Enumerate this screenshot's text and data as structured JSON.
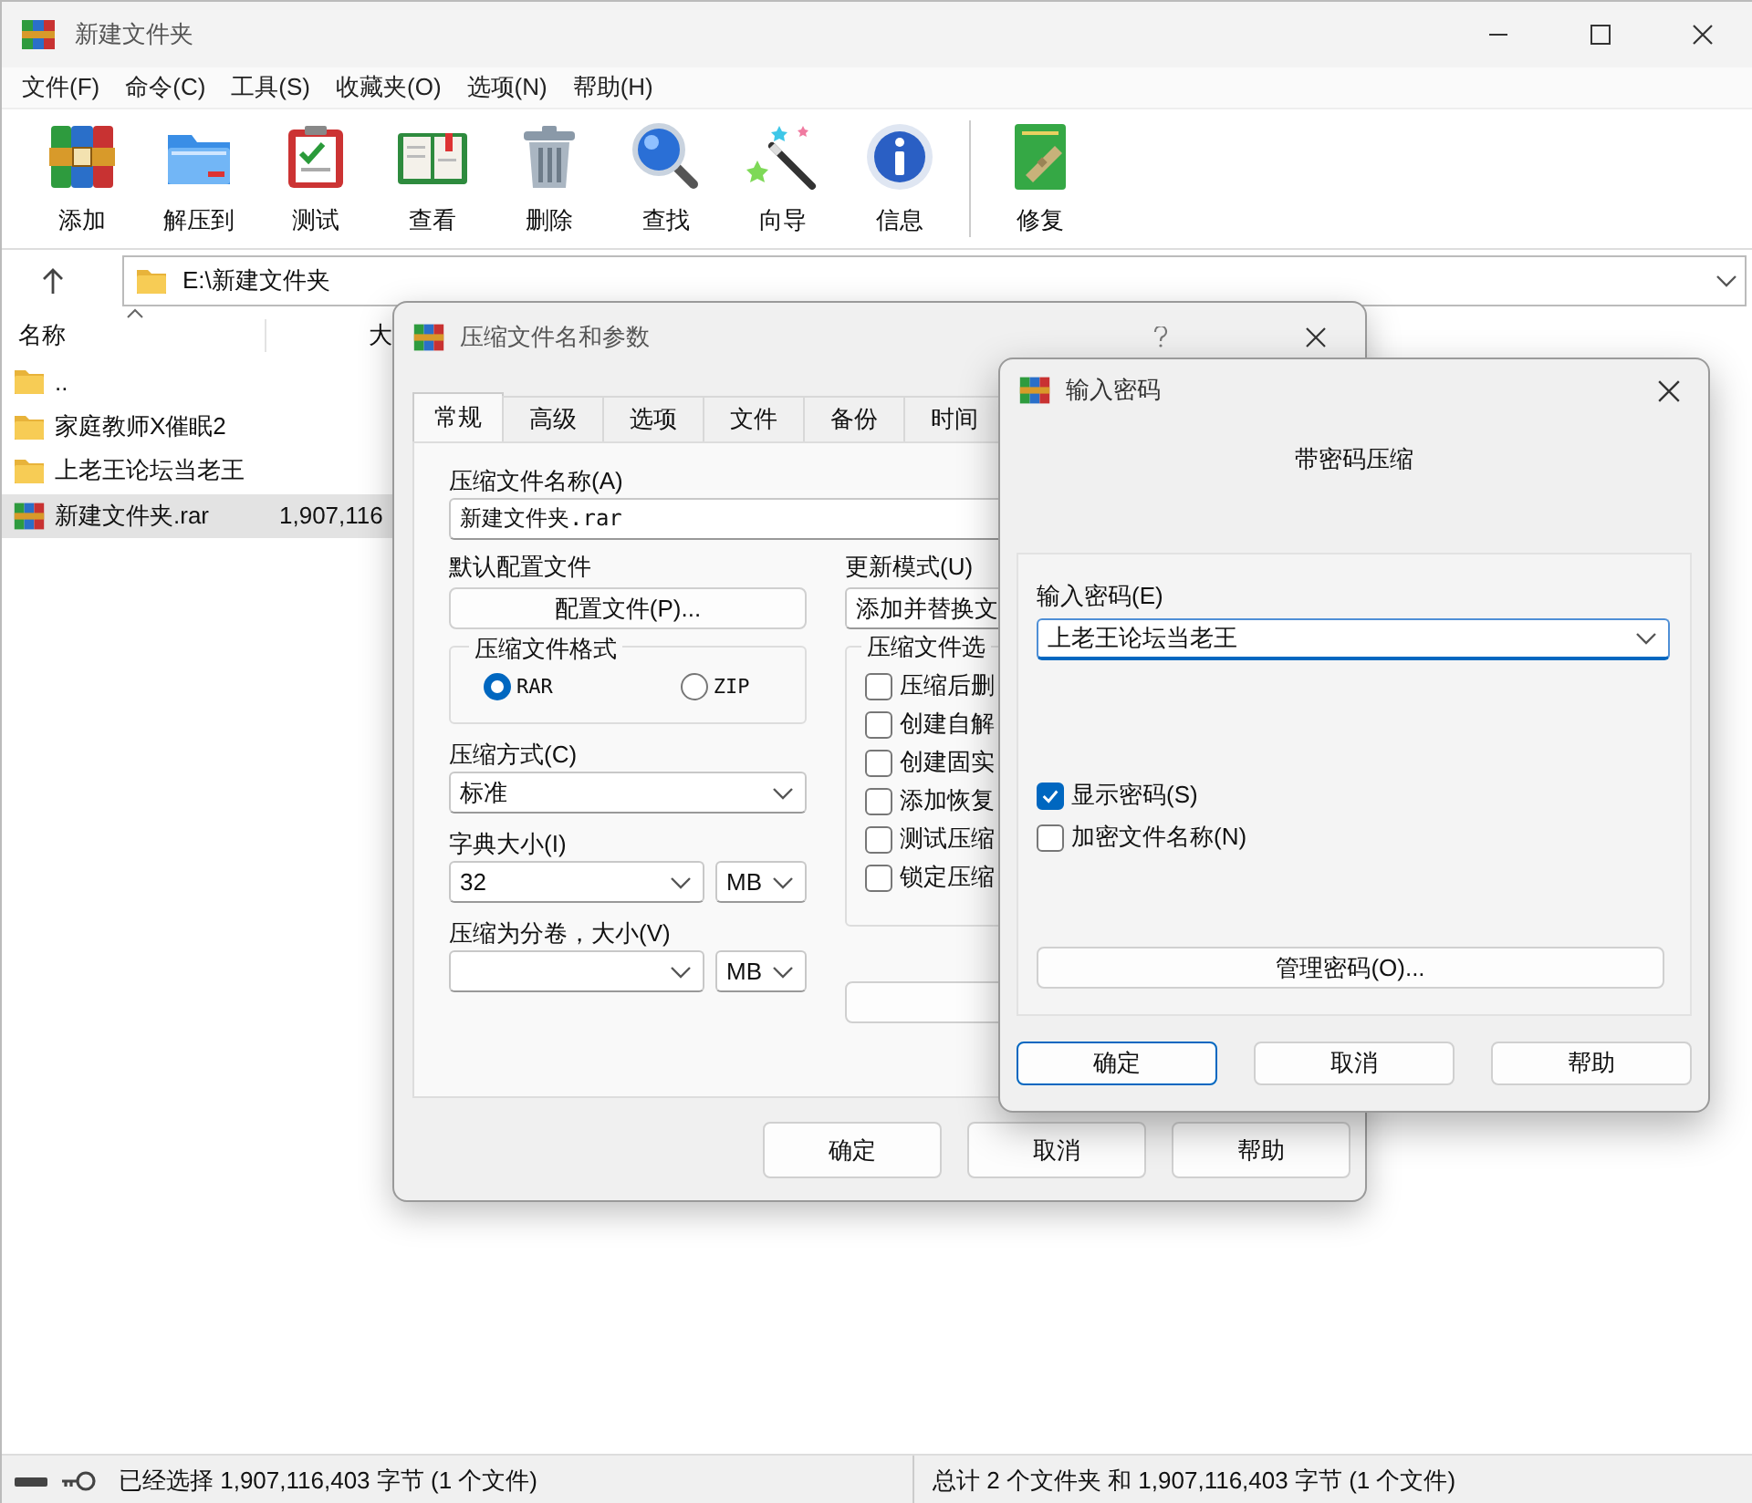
{
  "window": {
    "title": "新建文件夹"
  },
  "menu": [
    "文件(F)",
    "命令(C)",
    "工具(S)",
    "收藏夹(O)",
    "选项(N)",
    "帮助(H)"
  ],
  "toolbar": [
    {
      "label": "添加",
      "kind": "add"
    },
    {
      "label": "解压到",
      "kind": "extract"
    },
    {
      "label": "测试",
      "kind": "test"
    },
    {
      "label": "查看",
      "kind": "view"
    },
    {
      "label": "删除",
      "kind": "delete"
    },
    {
      "label": "查找",
      "kind": "find"
    },
    {
      "label": "向导",
      "kind": "wizard"
    },
    {
      "label": "信息",
      "kind": "info"
    },
    {
      "label": "修复",
      "kind": "repair"
    }
  ],
  "address": {
    "value": "E:\\新建文件夹"
  },
  "columns": [
    "名称",
    "大"
  ],
  "files": [
    {
      "name": "..",
      "kind": "folder",
      "selected": false
    },
    {
      "name": "家庭教师X催眠2",
      "kind": "folder",
      "selected": false
    },
    {
      "name": "上老王论坛当老王",
      "kind": "folder",
      "selected": false
    },
    {
      "name": "新建文件夹.rar",
      "kind": "archive",
      "size": "1,907,116",
      "selected": true
    }
  ],
  "status_bar": {
    "left": "已经选择 1,907,116,403 字节 (1 个文件)",
    "right": "总计 2 个文件夹 和 1,907,116,403 字节 (1 个文件)"
  },
  "archive_dialog": {
    "title": "压缩文件名和参数",
    "tabs": [
      {
        "label": "常规",
        "selected": true
      },
      {
        "label": "高级",
        "selected": false
      },
      {
        "label": "选项",
        "selected": false
      },
      {
        "label": "文件",
        "selected": false
      },
      {
        "label": "备份",
        "selected": false
      },
      {
        "label": "时间",
        "selected": false
      }
    ],
    "name_label": "压缩文件名称(A)",
    "name_value": "新建文件夹.rar",
    "profile_label": "默认配置文件",
    "profile_button": "配置文件(P)...",
    "update_label": "更新模式(U)",
    "update_value": "添加并替换文",
    "format_label": "压缩文件格式",
    "formats": [
      {
        "label": "RAR",
        "selected": true
      },
      {
        "label": "ZIP",
        "selected": false
      }
    ],
    "method_label": "压缩方式(C)",
    "method_value": "标准",
    "dict_label": "字典大小(I)",
    "dict_value": "32",
    "dict_unit": "MB",
    "volume_label": "压缩为分卷，大小(V)",
    "volume_unit": "MB",
    "options_label": "压缩文件选",
    "options": [
      {
        "label": "压缩后删",
        "checked": false
      },
      {
        "label": "创建自解",
        "checked": false
      },
      {
        "label": "创建固实",
        "checked": false
      },
      {
        "label": "添加恢复",
        "checked": false
      },
      {
        "label": "测试压缩",
        "checked": false
      },
      {
        "label": "锁定压缩",
        "checked": false
      }
    ],
    "buttons": [
      "确定",
      "取消",
      "帮助"
    ]
  },
  "password_dialog": {
    "title": "输入密码",
    "heading": "带密码压缩",
    "password_label": "输入密码(E)",
    "password": "上老王论坛当老王",
    "options": [
      {
        "label": "显示密码(S)",
        "checked": true
      },
      {
        "label": "加密文件名称(N)",
        "checked": false
      }
    ],
    "manage_button": "管理密码(O)...",
    "buttons": [
      {
        "label": "确定",
        "default": true
      },
      {
        "label": "取消",
        "default": false
      },
      {
        "label": "帮助",
        "default": false
      }
    ]
  }
}
